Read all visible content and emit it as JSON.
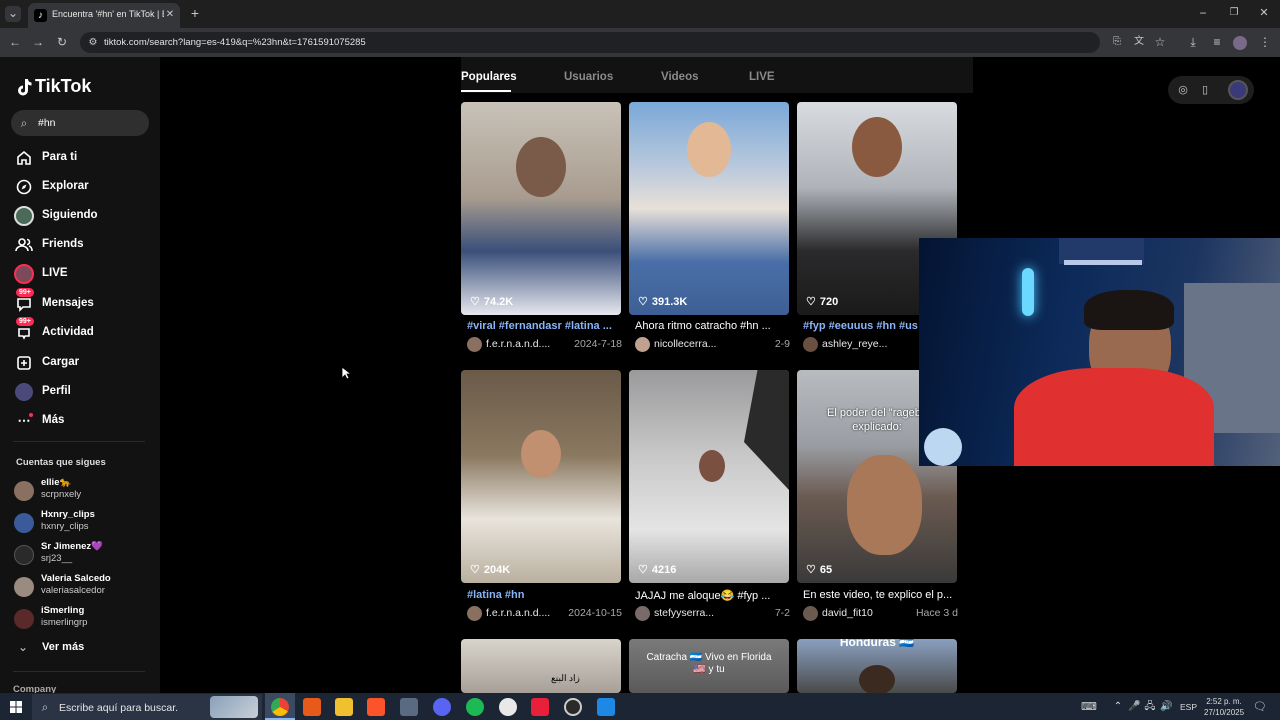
{
  "browser": {
    "tab_title": "Encuentra '#hn' en TikTok | Bus",
    "url": "tiktok.com/search?lang=es-419&q=%23hn&t=1761591075285"
  },
  "sidebar": {
    "logo": "TikTok",
    "search_value": "#hn",
    "nav": [
      {
        "label": "Para ti",
        "icon": "home-icon"
      },
      {
        "label": "Explorar",
        "icon": "compass-icon"
      },
      {
        "label": "Siguiendo",
        "icon": "following-avatar"
      },
      {
        "label": "Friends",
        "icon": "friends-icon"
      },
      {
        "label": "LIVE",
        "icon": "live-avatar"
      },
      {
        "label": "Mensajes",
        "icon": "messages-icon",
        "badge": "99+"
      },
      {
        "label": "Actividad",
        "icon": "activity-icon",
        "badge": "99+"
      },
      {
        "label": "Cargar",
        "icon": "upload-icon"
      },
      {
        "label": "Perfil",
        "icon": "profile-avatar"
      },
      {
        "label": "Más",
        "icon": "more-icon"
      }
    ],
    "following_title": "Cuentas que sigues",
    "following": [
      {
        "name": "ellie🐆",
        "handle": "scrpnxely"
      },
      {
        "name": "Hxnry_clips",
        "handle": "hxnry_clips"
      },
      {
        "name": "Sr Jimenez💜",
        "handle": "srj23__"
      },
      {
        "name": "Valeria Salcedo",
        "handle": "valeriasalcedor"
      },
      {
        "name": "iSmerling",
        "handle": "ismerlingrp"
      }
    ],
    "see_more": "Ver más",
    "company": "Company"
  },
  "search_tabs": [
    "Populares",
    "Usuarios",
    "Videos",
    "LIVE"
  ],
  "videos": [
    {
      "likes": "74.2K",
      "caption": "#viral #fernandasr #latina ...",
      "user": "f.e.r.n.a.n.d....",
      "date": "2024-7-18"
    },
    {
      "likes": "391.3K",
      "caption": "Ahora ritmo catracho #hn ...",
      "user": "nicollecerra...",
      "date": "2-9"
    },
    {
      "likes": "720",
      "caption": "#fyp #eeuuus #hn #us ...",
      "user": "ashley_reye...",
      "date": ""
    },
    {
      "likes": "204K",
      "caption": "#latina #hn",
      "user": "f.e.r.n.a.n.d....",
      "date": "2024-10-15"
    },
    {
      "likes": "4216",
      "caption": "JAJAJ me aloque😂 #fyp ...",
      "user": "stefyyserra...",
      "date": "7-2"
    },
    {
      "likes": "65",
      "caption": "En este video, te explico el p...",
      "user": "david_fit10",
      "date": "Hace 3 d"
    }
  ],
  "overlay_texts": {
    "v6": "El poder del \"rageba explicado:",
    "v8": "Catracha 🇭🇳 Vivo en Florida 🇺🇸 y tu",
    "v9": "Honduras 🇭🇳"
  },
  "taskbar": {
    "search_placeholder": "Escribe aquí para buscar.",
    "lang": "ESP",
    "time": "2:52 p. m.",
    "date": "27/10/2025"
  }
}
